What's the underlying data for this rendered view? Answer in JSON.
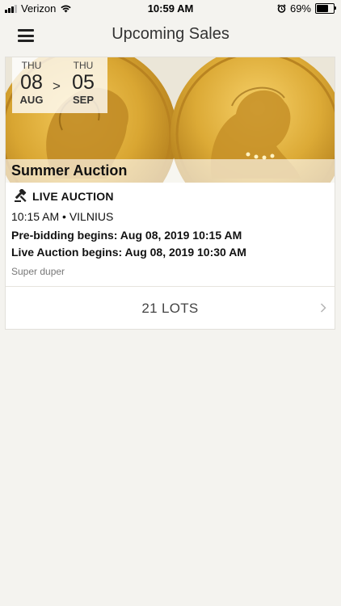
{
  "status_bar": {
    "carrier": "Verizon",
    "time": "10:59 AM",
    "battery": "69%",
    "battery_level": 0.69,
    "icons": [
      "signal-icon",
      "wifi-icon",
      "alarm-icon",
      "battery-icon"
    ]
  },
  "header": {
    "title": "Upcoming Sales",
    "menu_icon": "hamburger-menu-icon"
  },
  "sale": {
    "title": "Summer Auction",
    "start": {
      "dow": "THU",
      "day": "08",
      "month": "AUG"
    },
    "separator": ">",
    "end": {
      "dow": "THU",
      "day": "05",
      "month": "SEP"
    },
    "type_icon": "gavel-icon",
    "type": "LIVE AUCTION",
    "time_location": "10:15 AM • VILNIUS",
    "prebidding": "Pre-bidding begins: Aug 08, 2019 10:15 AM",
    "live_begins": "Live Auction begins: Aug 08, 2019 10:30 AM",
    "description": "Super duper",
    "lots": "21 LOTS"
  },
  "colors": {
    "background": "#f4f3ef",
    "card": "#ffffff",
    "coin_gold": "#d9a632"
  }
}
